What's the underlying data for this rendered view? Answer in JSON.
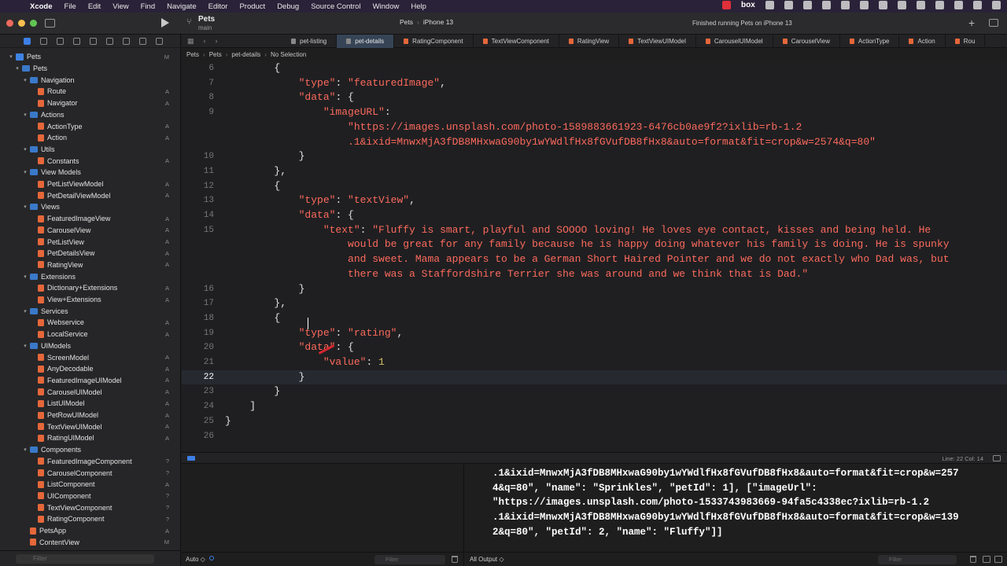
{
  "menubar": {
    "app": "Xcode",
    "items": [
      "File",
      "Edit",
      "View",
      "Find",
      "Navigate",
      "Editor",
      "Product",
      "Debug",
      "Source Control",
      "Window",
      "Help"
    ]
  },
  "toolbar": {
    "project": "Pets",
    "branch": "main",
    "scheme": "Pets",
    "device": "iPhone 13",
    "activity": "Finished running Pets on iPhone 13"
  },
  "navigator": {
    "filter_placeholder": "Filter",
    "rows": [
      {
        "label": "Pets",
        "level": 0,
        "kind": "proj",
        "status": "M",
        "open": true
      },
      {
        "label": "Pets",
        "level": 1,
        "kind": "folder",
        "status": "",
        "open": true
      },
      {
        "label": "Navigation",
        "level": 2,
        "kind": "folder",
        "status": "",
        "open": true
      },
      {
        "label": "Route",
        "level": 3,
        "kind": "swift",
        "status": "A"
      },
      {
        "label": "Navigator",
        "level": 3,
        "kind": "swift",
        "status": "A"
      },
      {
        "label": "Actions",
        "level": 2,
        "kind": "folder",
        "status": "",
        "open": true
      },
      {
        "label": "ActionType",
        "level": 3,
        "kind": "swift",
        "status": "A"
      },
      {
        "label": "Action",
        "level": 3,
        "kind": "swift",
        "status": "A"
      },
      {
        "label": "Utils",
        "level": 2,
        "kind": "folder",
        "status": "",
        "open": true
      },
      {
        "label": "Constants",
        "level": 3,
        "kind": "swift",
        "status": "A"
      },
      {
        "label": "View Models",
        "level": 2,
        "kind": "folder",
        "status": "",
        "open": true
      },
      {
        "label": "PetListViewModel",
        "level": 3,
        "kind": "swift",
        "status": "A"
      },
      {
        "label": "PetDetailViewModel",
        "level": 3,
        "kind": "swift",
        "status": "A"
      },
      {
        "label": "Views",
        "level": 2,
        "kind": "folder",
        "status": "",
        "open": true
      },
      {
        "label": "FeaturedImageView",
        "level": 3,
        "kind": "swift",
        "status": "A"
      },
      {
        "label": "CarouselView",
        "level": 3,
        "kind": "swift",
        "status": "A"
      },
      {
        "label": "PetListView",
        "level": 3,
        "kind": "swift",
        "status": "A"
      },
      {
        "label": "PetDetailsView",
        "level": 3,
        "kind": "swift",
        "status": "A"
      },
      {
        "label": "RatingView",
        "level": 3,
        "kind": "swift",
        "status": "A"
      },
      {
        "label": "Extensions",
        "level": 2,
        "kind": "folder",
        "status": "",
        "open": true
      },
      {
        "label": "Dictionary+Extensions",
        "level": 3,
        "kind": "swift",
        "status": "A"
      },
      {
        "label": "View+Extensions",
        "level": 3,
        "kind": "swift",
        "status": "A"
      },
      {
        "label": "Services",
        "level": 2,
        "kind": "folder",
        "status": "",
        "open": true
      },
      {
        "label": "Webservice",
        "level": 3,
        "kind": "swift",
        "status": "A"
      },
      {
        "label": "LocalService",
        "level": 3,
        "kind": "swift",
        "status": "A"
      },
      {
        "label": "UIModels",
        "level": 2,
        "kind": "folder",
        "status": "",
        "open": true
      },
      {
        "label": "ScreenModel",
        "level": 3,
        "kind": "swift",
        "status": "A"
      },
      {
        "label": "AnyDecodable",
        "level": 3,
        "kind": "swift",
        "status": "A"
      },
      {
        "label": "FeaturedImageUIModel",
        "level": 3,
        "kind": "swift",
        "status": "A"
      },
      {
        "label": "CarouselUIModel",
        "level": 3,
        "kind": "swift",
        "status": "A"
      },
      {
        "label": "ListUIModel",
        "level": 3,
        "kind": "swift",
        "status": "A"
      },
      {
        "label": "PetRowUIModel",
        "level": 3,
        "kind": "swift",
        "status": "A"
      },
      {
        "label": "TextViewUIModel",
        "level": 3,
        "kind": "swift",
        "status": "A"
      },
      {
        "label": "RatingUIModel",
        "level": 3,
        "kind": "swift",
        "status": "A"
      },
      {
        "label": "Components",
        "level": 2,
        "kind": "folder",
        "status": "",
        "open": true
      },
      {
        "label": "FeaturedImageComponent",
        "level": 3,
        "kind": "swift",
        "status": "?"
      },
      {
        "label": "CarouselComponent",
        "level": 3,
        "kind": "swift",
        "status": "?"
      },
      {
        "label": "ListComponent",
        "level": 3,
        "kind": "swift",
        "status": "A"
      },
      {
        "label": "UIComponent",
        "level": 3,
        "kind": "swift",
        "status": "?"
      },
      {
        "label": "TextViewComponent",
        "level": 3,
        "kind": "swift",
        "status": "?"
      },
      {
        "label": "RatingComponent",
        "level": 3,
        "kind": "swift",
        "status": "?"
      },
      {
        "label": "PetsApp",
        "level": 2,
        "kind": "swift",
        "status": "A"
      },
      {
        "label": "ContentView",
        "level": 2,
        "kind": "swift",
        "status": "M"
      }
    ]
  },
  "tabs": [
    {
      "label": "pet-listing",
      "kind": "json",
      "active": false
    },
    {
      "label": "pet-details",
      "kind": "json",
      "active": true
    },
    {
      "label": "RatingComponent",
      "kind": "swift",
      "active": false
    },
    {
      "label": "TextViewComponent",
      "kind": "swift",
      "active": false
    },
    {
      "label": "RatingView",
      "kind": "swift",
      "active": false
    },
    {
      "label": "TextViewUIModel",
      "kind": "swift",
      "active": false
    },
    {
      "label": "CarouselUIModel",
      "kind": "swift",
      "active": false
    },
    {
      "label": "CarouselView",
      "kind": "swift",
      "active": false
    },
    {
      "label": "ActionType",
      "kind": "swift",
      "active": false
    },
    {
      "label": "Action",
      "kind": "swift",
      "active": false
    },
    {
      "label": "Rou",
      "kind": "swift",
      "active": false
    }
  ],
  "breadcrumb": [
    "Pets",
    "Pets",
    "pet-details",
    "No Selection"
  ],
  "editor": {
    "current_line": "22",
    "lines": [
      {
        "n": "6",
        "tokens": [
          [
            "pun",
            "        {"
          ]
        ]
      },
      {
        "n": "7",
        "tokens": [
          [
            "str",
            "            \"type\""
          ],
          [
            "pun",
            ": "
          ],
          [
            "str",
            "\"featuredImage\""
          ],
          [
            "pun",
            ","
          ]
        ]
      },
      {
        "n": "8",
        "tokens": [
          [
            "str",
            "            \"data\""
          ],
          [
            "pun",
            ": {"
          ]
        ]
      },
      {
        "n": "9",
        "tokens": [
          [
            "str",
            "                \"imageURL\""
          ],
          [
            "pun",
            ":"
          ]
        ]
      },
      {
        "n": "",
        "tokens": [
          [
            "str",
            "                    \"https://images.unsplash.com/photo-1589883661923-6476cb0ae9f2?ixlib=rb-1.2"
          ]
        ]
      },
      {
        "n": "",
        "tokens": [
          [
            "str",
            "                    .1&ixid=MnwxMjA3fDB8MHxwaG90by1wYWdlfHx8fGVufDB8fHx8&auto=format&fit=crop&w=2574&q=80\""
          ]
        ]
      },
      {
        "n": "10",
        "tokens": [
          [
            "pun",
            "            }"
          ]
        ]
      },
      {
        "n": "11",
        "tokens": [
          [
            "pun",
            "        },"
          ]
        ]
      },
      {
        "n": "12",
        "tokens": [
          [
            "pun",
            "        {"
          ]
        ]
      },
      {
        "n": "13",
        "tokens": [
          [
            "str",
            "            \"type\""
          ],
          [
            "pun",
            ": "
          ],
          [
            "str",
            "\"textView\""
          ],
          [
            "pun",
            ","
          ]
        ]
      },
      {
        "n": "14",
        "tokens": [
          [
            "str",
            "            \"data\""
          ],
          [
            "pun",
            ": {"
          ]
        ]
      },
      {
        "n": "15",
        "tokens": [
          [
            "str",
            "                \"text\""
          ],
          [
            "pun",
            ": "
          ],
          [
            "str",
            "\"Fluffy is smart, playful and SOOOO loving! He loves eye contact, kisses and being held. He"
          ]
        ]
      },
      {
        "n": "",
        "tokens": [
          [
            "str",
            "                    would be great for any family because he is happy doing whatever his family is doing. He is spunky"
          ]
        ]
      },
      {
        "n": "",
        "tokens": [
          [
            "str",
            "                    and sweet. Mama appears to be a German Short Haired Pointer and we do not exactly who Dad was, but"
          ]
        ]
      },
      {
        "n": "",
        "tokens": [
          [
            "str",
            "                    there was a Staffordshire Terrier she was around and we think that is Dad.\""
          ]
        ]
      },
      {
        "n": "16",
        "tokens": [
          [
            "pun",
            "            }"
          ]
        ]
      },
      {
        "n": "17",
        "tokens": [
          [
            "pun",
            "        },"
          ]
        ]
      },
      {
        "n": "18",
        "tokens": [
          [
            "pun",
            "        {"
          ]
        ]
      },
      {
        "n": "19",
        "tokens": [
          [
            "str",
            "            \"type\""
          ],
          [
            "pun",
            ": "
          ],
          [
            "str",
            "\"rating\""
          ],
          [
            "pun",
            ","
          ]
        ]
      },
      {
        "n": "20",
        "tokens": [
          [
            "str",
            "            \"data\""
          ],
          [
            "pun",
            ": {"
          ]
        ]
      },
      {
        "n": "21",
        "tokens": [
          [
            "str",
            "                \"value\""
          ],
          [
            "pun",
            ": "
          ],
          [
            "num",
            "1"
          ]
        ]
      },
      {
        "n": "22",
        "tokens": [
          [
            "pun",
            "            }"
          ]
        ]
      },
      {
        "n": "23",
        "tokens": [
          [
            "pun",
            "        }"
          ]
        ]
      },
      {
        "n": "24",
        "tokens": [
          [
            "pun",
            "    ]"
          ]
        ]
      },
      {
        "n": "25",
        "tokens": [
          [
            "pun",
            "}"
          ]
        ]
      },
      {
        "n": "26",
        "tokens": [
          [
            "pun",
            ""
          ]
        ]
      }
    ]
  },
  "debug": {
    "line_col": "Line: 22  Col: 14",
    "variables_scope": "Auto ◇",
    "variables_filter": "Filter",
    "output_scope": "All Output ◇",
    "console_filter": "Filter",
    "console_text": ".1&ixid=MnwxMjA3fDB8MHxwaG90by1wYWdlfHx8fGVufDB8fHx8&auto=format&fit=crop&w=257\n4&q=80\", \"name\": \"Sprinkles\", \"petId\": 1], [\"imageUrl\":\n\"https://images.unsplash.com/photo-1533743983669-94fa5c4338ec?ixlib=rb-1.2\n.1&ixid=MnwxMjA3fDB8MHxwaG90by1wYWdlfHx8fGVufDB8fHx8&auto=format&fit=crop&w=139\n2&q=80\", \"petId\": 2, \"name\": \"Fluffy\"]]"
  },
  "colors": {
    "accent": "#3d7fe6",
    "string": "#fc6a5d",
    "number": "#d0bf69",
    "annotation": "#d8262f"
  }
}
